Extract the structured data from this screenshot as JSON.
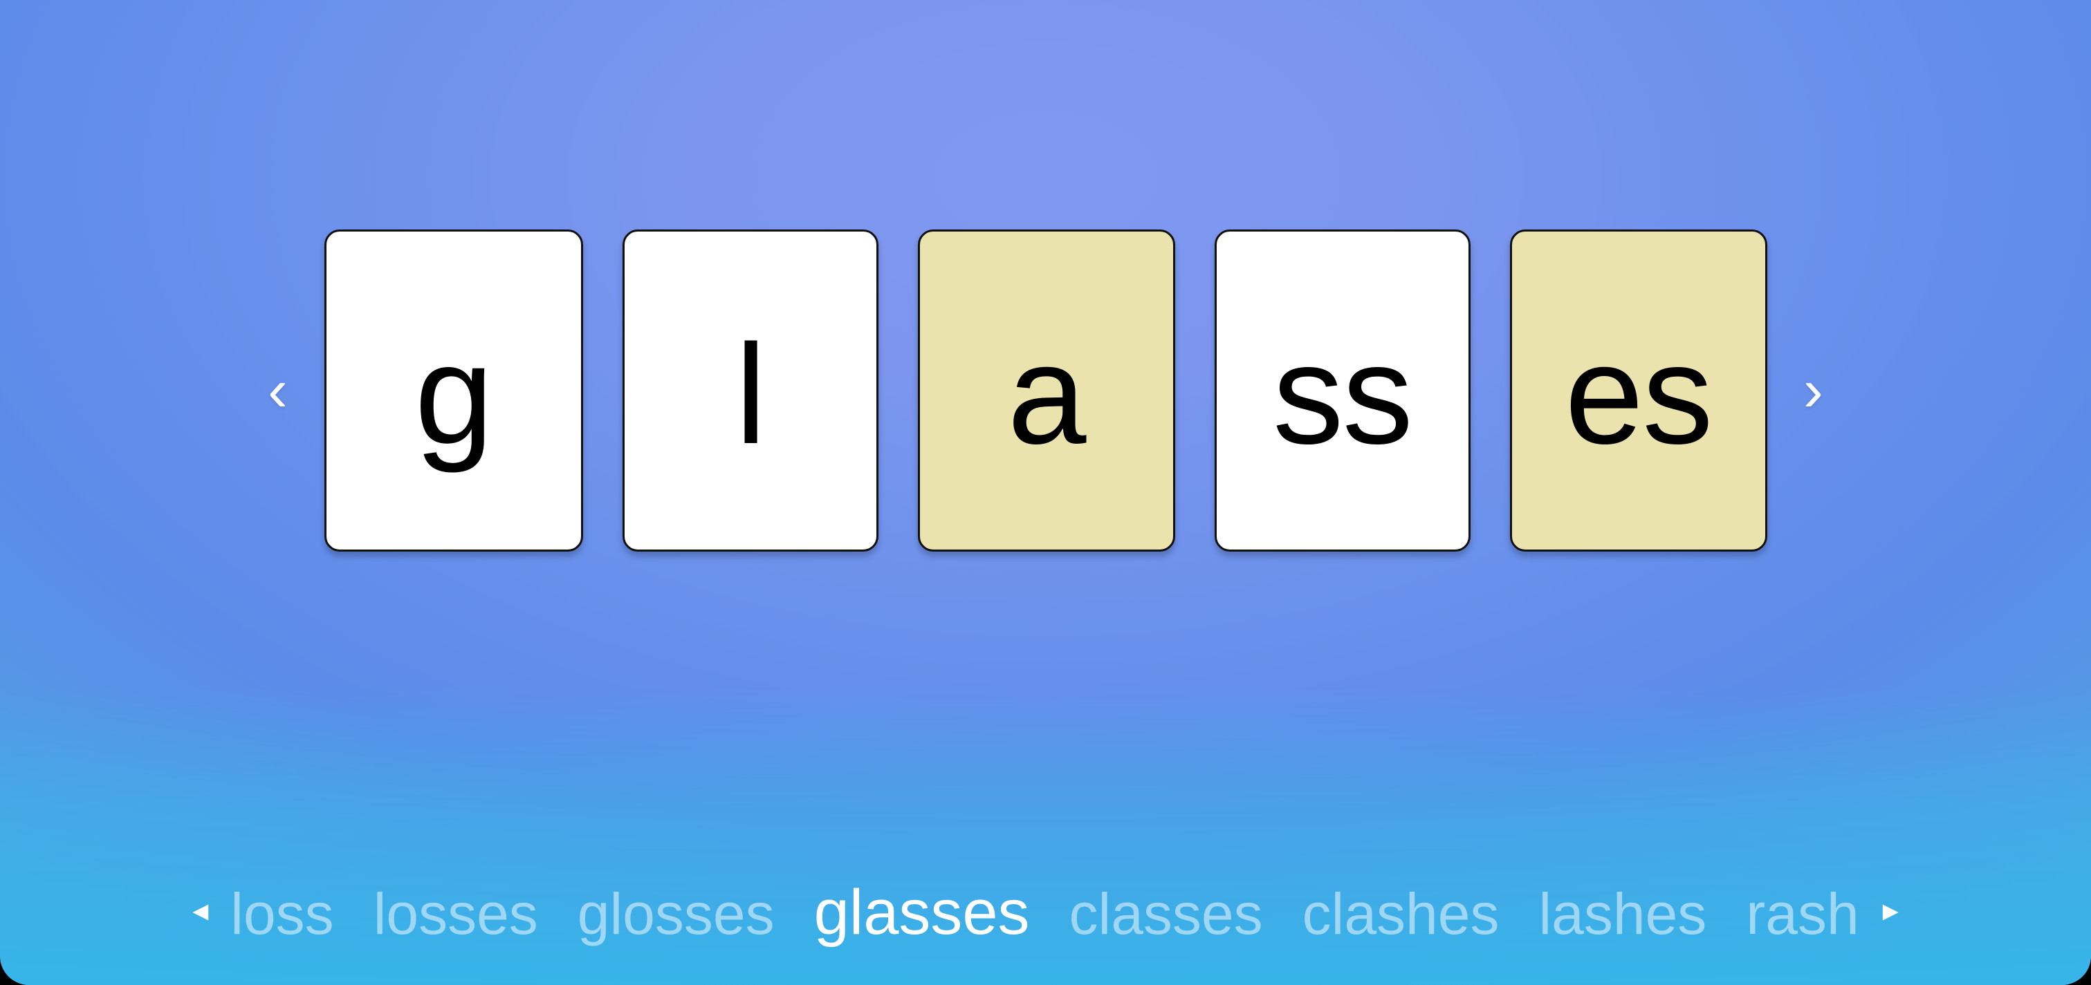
{
  "app": {
    "background_corner_color": "#3FB0E5",
    "background_center_color": "#7B97EE"
  },
  "tiles_area": {
    "prev_chevron_icon": "‹",
    "next_chevron_icon": "›",
    "tiles": [
      {
        "letter": "g",
        "color_name": "white",
        "color": "#FFFFFF"
      },
      {
        "letter": "l",
        "color_name": "white",
        "color": "#FFFFFF"
      },
      {
        "letter": "a",
        "color_name": "yellow",
        "color": "#EAE3AE"
      },
      {
        "letter": "ss",
        "color_name": "white",
        "color": "#FFFFFF"
      },
      {
        "letter": "es",
        "color_name": "yellow",
        "color": "#EAE3AE"
      }
    ]
  },
  "word_strip": {
    "scroll_left_icon": "◂",
    "scroll_right_icon": "▸",
    "active_word": "glasses",
    "words": [
      {
        "text": "loss",
        "active": false
      },
      {
        "text": "losses",
        "active": false
      },
      {
        "text": "glosses",
        "active": false
      },
      {
        "text": "glasses",
        "active": true
      },
      {
        "text": "classes",
        "active": false
      },
      {
        "text": "clashes",
        "active": false
      },
      {
        "text": "lashes",
        "active": false
      },
      {
        "text": "rash",
        "active": false
      }
    ]
  }
}
